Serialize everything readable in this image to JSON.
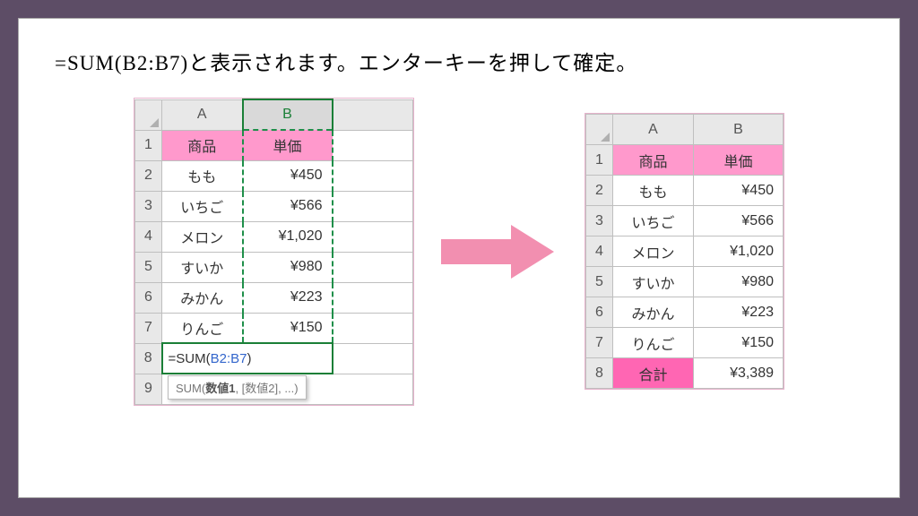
{
  "caption": "=SUM(B2:B7)と表示されます。エンターキーを押して確定。",
  "headers": {
    "A": "A",
    "B": "B",
    "product": "商品",
    "price": "単価",
    "total": "合計"
  },
  "rows": [
    {
      "n": "1"
    },
    {
      "n": "2",
      "p": "もも",
      "y": "¥450"
    },
    {
      "n": "3",
      "p": "いちご",
      "y": "¥566"
    },
    {
      "n": "4",
      "p": "メロン",
      "y": "¥1,020"
    },
    {
      "n": "5",
      "p": "すいか",
      "y": "¥980"
    },
    {
      "n": "6",
      "p": "みかん",
      "y": "¥223"
    },
    {
      "n": "7",
      "p": "りんご",
      "y": "¥150"
    },
    {
      "n": "8"
    },
    {
      "n": "9"
    }
  ],
  "formula": {
    "prefix": "=SUM(",
    "ref": "B2:B7",
    "suffix": ")"
  },
  "tooltip": {
    "bold": "数値1",
    "rest": ", [数値2], ...)",
    "fn": "SUM("
  },
  "result": "¥3,389"
}
